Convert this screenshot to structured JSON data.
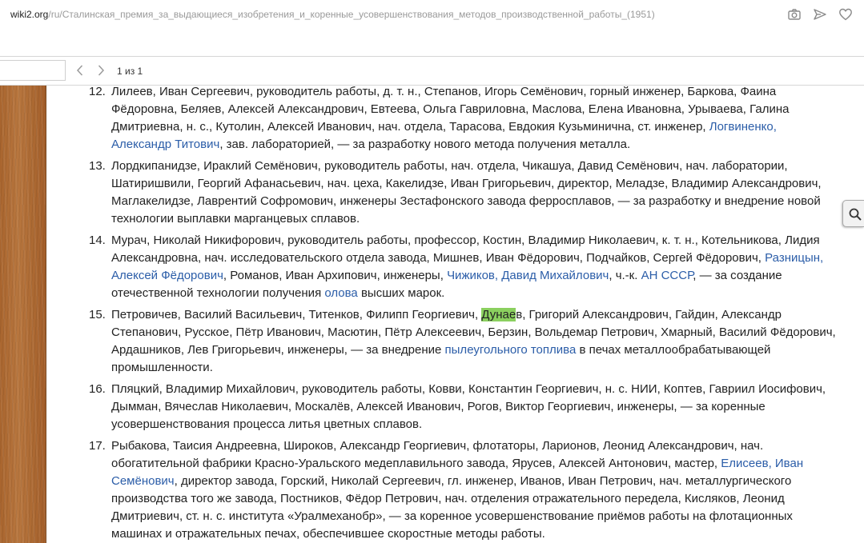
{
  "browser": {
    "url_domain": "wiki2.org",
    "url_path": "/ru/Сталинская_премия_за_выдающиеся_изобретения_и_коренные_усовершенствования_методов_производственной_работы_(1951)",
    "icons": [
      "camera-icon",
      "send-icon",
      "heart-icon"
    ]
  },
  "findbar": {
    "input_value": "",
    "count": "1 из 1",
    "highlight_color": "#8bd05f"
  },
  "items": [
    {
      "num": "12.",
      "p1": "Лилеев, Иван Сергеевич, руководитель работы, д. т. н., Степанов, Игорь Семёнович, горный инженер, Баркова, Фаина Фёдоровна, Беляев, Алексей Александрович, Евтеева, Ольга Гавриловна, Маслова, Елена Ивановна, Урываева, Галина Дмитриевна, н. с., Кутолин, Алексей Иванович, нач. отдела, Тарасова, Евдокия Кузьминична, ст. инженер, ",
      "link1": "Логвиненко, Александр Титович",
      "p2": ", зав. лабораторией, — за разработку нового метода получения металла."
    },
    {
      "num": "13.",
      "p1": "Лордкипанидзе, Ираклий Семёнович, руководитель работы, нач. отдела, Чикашуа, Давид Семёнович, нач. лаборатории, Шатиришвили, Георгий Афанасьевич, нач. цеха, Какелидзе, Иван Григорьевич, директор, Меладзе, Владимир Александрович, Маглакелидзе, Лаврентий Софромович, инженеры Зестафонского завода ферросплавов, — за разработку и внедрение новой технологии выплавки марганцевых сплавов."
    },
    {
      "num": "14.",
      "p1": "Мурач, Николай Никифорович, руководитель работы, профессор, Костин, Владимир Николаевич, к. т. н., Котельникова, Лидия Александровна, нач. исследовательского отдела завода, Мишнев, Иван Фёдорович, Подчайков, Сергей Фёдорович, ",
      "link1": "Разницын, Алексей Фёдорович",
      "p2": ", Романов, Иван Архипович, инженеры, ",
      "link2": "Чижиков, Давид Михайлович",
      "p3": ", ч.-к. ",
      "link3": "АН СССР",
      "p4": ", — за создание отечественной технологии получения ",
      "link4": "олова",
      "p5": " высших марок."
    },
    {
      "num": "15.",
      "p1": "Петровичев, Василий Васильевич, Титенков, Филипп Георгиевич, ",
      "highlight": "Дунае",
      "p2": "в, Григорий Александрович, Гайдин, Александр Степанович, Русское, Пётр Иванович, Масютин, Пётр Алексеевич, Берзин, Вольдемар Петрович, Хмарный, Василий Фёдорович, Ардашников, Лев Григорьевич, инженеры, — за внедрение ",
      "link1": "пылеугольного топлива",
      "p3": " в печах металлообрабатывающей промышленности."
    },
    {
      "num": "16.",
      "p1": "Пляцкий, Владимир Михайлович, руководитель работы, Ковви, Константин Георгиевич, н. с. НИИ, Коптев, Гавриил Иосифович, Дымман, Вячеслав Николаевич, Москалёв, Алексей Иванович, Рогов, Виктор Георгиевич, инженеры, — за коренные усовершенствования процесса литья цветных сплавов."
    },
    {
      "num": "17.",
      "p1": "Рыбакова, Таисия Андреевна, Широков, Александр Георгиевич, флотаторы, Ларионов, Леонид Александрович, нач. обогатительной фабрики Красно-Уральского медеплавильного завода, Ярусев, Алексей Антонович, мастер, ",
      "link1": "Елисеев, Иван Семёнович",
      "p2": ", директор завода, Горский, Николай Сергеевич, гл. инженер, Иванов, Иван Петрович, нач. металлургического производства того же завода, Постников, Фёдор Петрович, нач. отделения отражательного передела, Кисляков, Леонид Дмитриевич, ст. н. с. института «Уралмеханобр», — за коренное усовершенствование приёмов работы на флотационных машинах и отражательных печах, обеспечившее скоростные методы работы."
    }
  ]
}
